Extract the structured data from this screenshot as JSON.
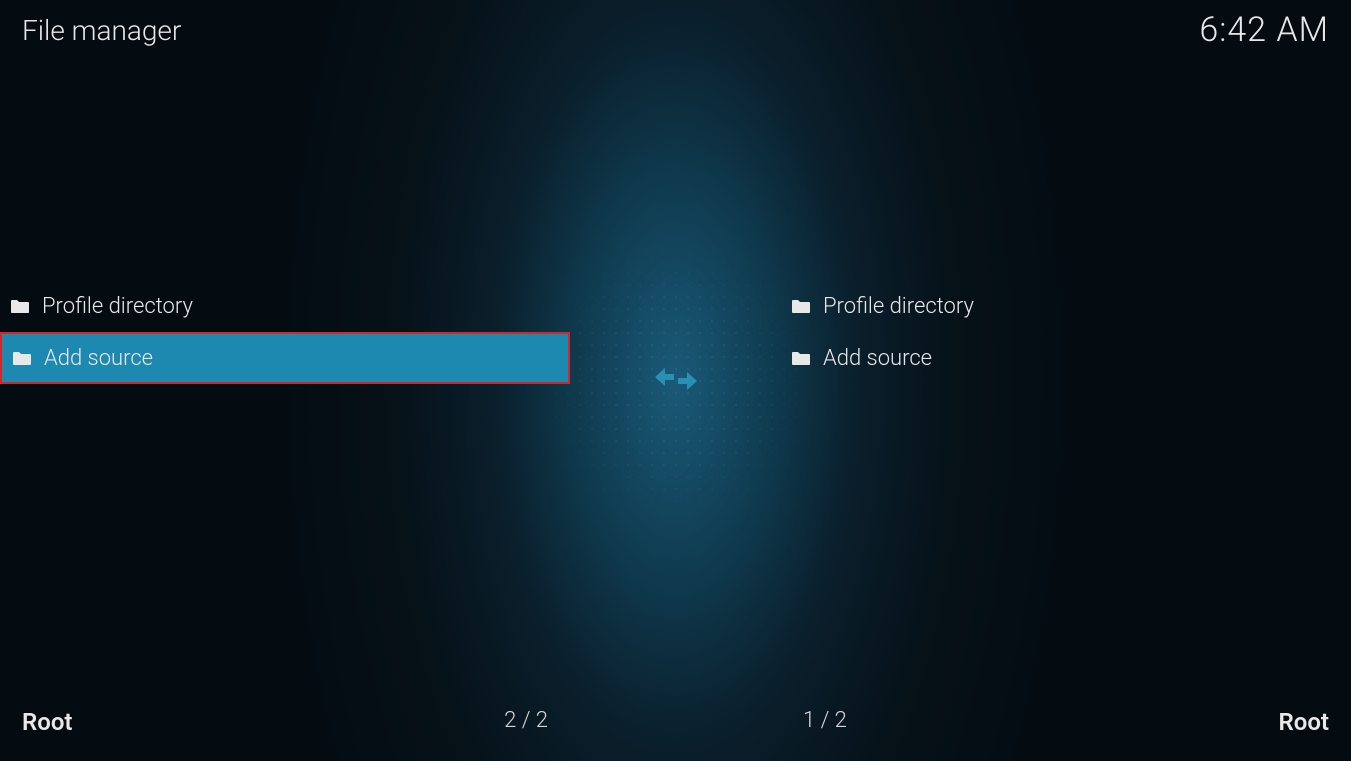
{
  "header": {
    "title": "File manager",
    "clock": "6:42 AM"
  },
  "left_pane": {
    "items": [
      {
        "label": "Profile directory",
        "selected": false
      },
      {
        "label": "Add source",
        "selected": true
      }
    ],
    "footer_label": "Root",
    "footer_count": "2 / 2"
  },
  "right_pane": {
    "items": [
      {
        "label": "Profile directory",
        "selected": false
      },
      {
        "label": "Add source",
        "selected": false
      }
    ],
    "footer_label": "Root",
    "footer_count": "1 / 2"
  }
}
